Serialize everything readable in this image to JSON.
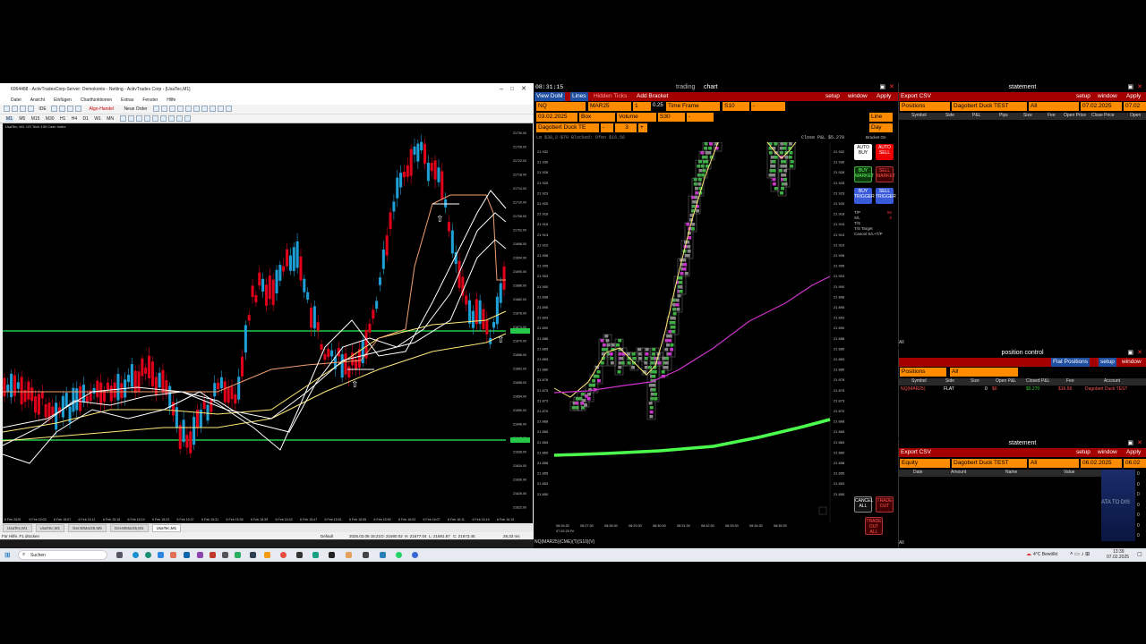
{
  "mt": {
    "title": "6064488 - ActivTradesCorp-Server: Demokonto - Netting - ActivTrades Corp - [UsaTec,M1]",
    "menu": [
      "Datei",
      "Ansicht",
      "Einfügen",
      "Chartfunktionen",
      "Extras",
      "Fenster",
      "Hilfe"
    ],
    "toolbar": {
      "algo": "Algo-Handel",
      "new_order": "Neue Order",
      "ide": "IDE"
    },
    "timeframes": [
      "M1",
      "M5",
      "M15",
      "M30",
      "H1",
      "H4",
      "D1",
      "W1",
      "MN"
    ],
    "chart_caption": "UsaTec, M1: US Tech 100 Cash Index",
    "tabs": [
      "UsaTec,M1",
      "UsaTec,M1",
      "Ger40Mar25,M5",
      "Ger40Mar25,M1",
      "UsaTec,M1"
    ],
    "status_help": "Für Hilfe, F1 drücken",
    "status_profile": "Default",
    "status_time": "2025.02.06 16:21",
    "status_o": "O: 21680.02",
    "status_h": "H: 21677.04",
    "status_l": "L: 21681.87",
    "status_c": "C: 21673.45",
    "status_ping": "28,33 ms",
    "price_labels": [
      "21730.00",
      "21726.00",
      "21722.00",
      "21718.00",
      "21714.00",
      "21710.00",
      "21706.00",
      "21702.00",
      "21698.00",
      "21694.00",
      "21690.00",
      "21686.00",
      "21682.00",
      "21678.00",
      "21674.00",
      "21670.00",
      "21666.00",
      "21662.00",
      "21658.00",
      "21654.00",
      "21650.00",
      "21646.00",
      "21642.00",
      "21638.00",
      "21634.00",
      "21630.00",
      "21626.00",
      "21622.00"
    ],
    "time_labels": [
      "6 Feb 2025",
      "6 Feb 15:03",
      "6 Feb 15:07",
      "6 Feb 15:11",
      "6 Feb 15:15",
      "6 Feb 15:19",
      "6 Feb 15:23",
      "6 Feb 15:27",
      "6 Feb 15:31",
      "6 Feb 15:35",
      "6 Feb 15:39",
      "6 Feb 15:43",
      "6 Feb 15:47",
      "6 Feb 15:51",
      "6 Feb 15:55",
      "6 Feb 15:59",
      "6 Feb 16:03",
      "6 Feb 16:07",
      "6 Feb 16:11",
      "6 Feb 16:15",
      "6 Feb 16:19"
    ]
  },
  "tt": {
    "clock": "08:31:15",
    "trading_label": "trading",
    "chart_label": "chart",
    "view_dom": "View DoM",
    "lines": "Lines",
    "hidden_ticks": "Hidden Ticks",
    "add_bracket": "Add Bracket",
    "setup": "setup",
    "window": "window",
    "apply": "Apply",
    "symbol": "NQ",
    "contract": "MAR25",
    "qty": "1",
    "tick": "0.25",
    "time_frame": "Time Frame",
    "s10": "S10",
    "dash": "-",
    "date": "03.02.2025",
    "box": "Box",
    "volume": "Volume",
    "s30": "S30",
    "line": "Line",
    "day": "Day",
    "account": "Dagobert Duck TE",
    "three": "3",
    "info_line": "Lm $38,2-$70 Blocked: Ofen $16.56",
    "close_pnl": "Close P&L $5.270",
    "bracket_on": "Bracket On",
    "btn_auto_buy": "AUTO BUY",
    "btn_auto_sell": "AUTO SELL",
    "btn_buy_market": "BUY MARKET",
    "btn_sell_market": "SELL MARKET",
    "btn_buy_trigger": "BUY TRIGGER",
    "btn_sell_trigger": "SELL TRIGGER",
    "side_labels": [
      "T/P",
      "S/L",
      "T/S",
      "T/S Target",
      "Cancel S/L+T/P"
    ],
    "side_vals": [
      "50",
      "5"
    ],
    "btn_cancel_all": "CANCEL ALL",
    "btn_trade_out": "TRADE OUT",
    "btn_trade_out_all": "TRADE OUT ALL",
    "footer": "NQ(MAR25)(CME)(T)(S10)(V)",
    "dom_prices": [
      "21 932",
      "21 930",
      "21 928",
      "21 925",
      "21 923",
      "21 920",
      "21 918",
      "21 915",
      "21 913",
      "21 910",
      "21 908",
      "21 905",
      "21 903",
      "21 900",
      "21 898",
      "21 895",
      "21 893",
      "21 890",
      "21 888",
      "21 885",
      "21 883",
      "21 880",
      "21 878",
      "21 875",
      "21 873",
      "21 870",
      "21 868",
      "21 865",
      "21 863",
      "21 860",
      "21 858",
      "21 855",
      "21 853",
      "21 850"
    ],
    "times": [
      "08:26:30",
      "08:27:30",
      "08:28:30",
      "08:29:30",
      "08:30:30",
      "08:31:30",
      "08:32:30",
      "08:33:30",
      "08:34:30",
      "08:35:30"
    ],
    "date_stamp": "07.02.25 Fri"
  },
  "statement1": {
    "title": "statement",
    "export": "Export CSV",
    "setup": "setup",
    "window": "window",
    "apply": "Apply",
    "type": "Positions",
    "account": "Dagobert Duck TEST",
    "all": "All",
    "date1": "07.02.2025",
    "date2": "07.02",
    "cols": [
      "Symbol",
      "Side",
      "P&L",
      "Pips",
      "Size",
      "Fee",
      "Open Price",
      "Close Price",
      "Open"
    ],
    "footer": "All"
  },
  "position": {
    "title": "position control",
    "flat": "Flat Positions",
    "setup": "setup",
    "window": "window",
    "type": "Positions",
    "all": "All",
    "cols": [
      "Symbol",
      "Side",
      "Size",
      "Open P&L",
      "Closed P&L",
      "Fee",
      "Account"
    ],
    "row": [
      "NQ(MAR25)",
      "FLAT",
      "0",
      "$0",
      "$5.270",
      "$16.56",
      "Dagobert Duck TEST"
    ]
  },
  "statement2": {
    "title": "statement",
    "export": "Export CSV",
    "setup": "setup",
    "window": "window",
    "apply": "Apply",
    "type": "Equity",
    "account": "Dagobert Duck TEST",
    "all": "All",
    "date1": "06.02.2025",
    "date2": "06.02",
    "cols": [
      "Date",
      "Amount",
      "Name",
      "Value"
    ],
    "no_data": "ATA TO DIS",
    "axis": [
      "0",
      "0",
      "0",
      "0",
      "0",
      "0",
      "0"
    ],
    "footer": "All"
  },
  "taskbar": {
    "search": "Suchen",
    "weather": "4°C Bewölkt",
    "time": "13:39",
    "date": "07.02.2025"
  },
  "colors": {
    "orange": "#ff8c00",
    "red": "#a50000",
    "green": "#26c84a",
    "teal": "#1ea0d6",
    "candle_red": "#e0001a"
  }
}
